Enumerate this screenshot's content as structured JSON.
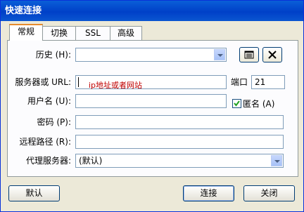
{
  "window": {
    "title": "快速连接"
  },
  "tabs": [
    {
      "label": "常规"
    },
    {
      "label": "切换"
    },
    {
      "label": "SSL"
    },
    {
      "label": "高级"
    }
  ],
  "form": {
    "history_label": "历史 (H):",
    "history_value": "",
    "server_label": "服务器或 URL:",
    "server_value": "",
    "server_hint": "ip地址或者网站",
    "port_label": "端口",
    "port_value": "21",
    "username_label": "用户名 (U):",
    "username_value": "",
    "anonymous_label": "匿名 (A)",
    "anonymous_checked": true,
    "password_label": "密码 (P):",
    "password_value": "",
    "remote_path_label": "远程路径 (R):",
    "remote_path_value": "",
    "proxy_label": "代理服务器:",
    "proxy_value": "(默认)"
  },
  "buttons": {
    "default": "默认",
    "connect": "连接",
    "close": "关闭"
  }
}
